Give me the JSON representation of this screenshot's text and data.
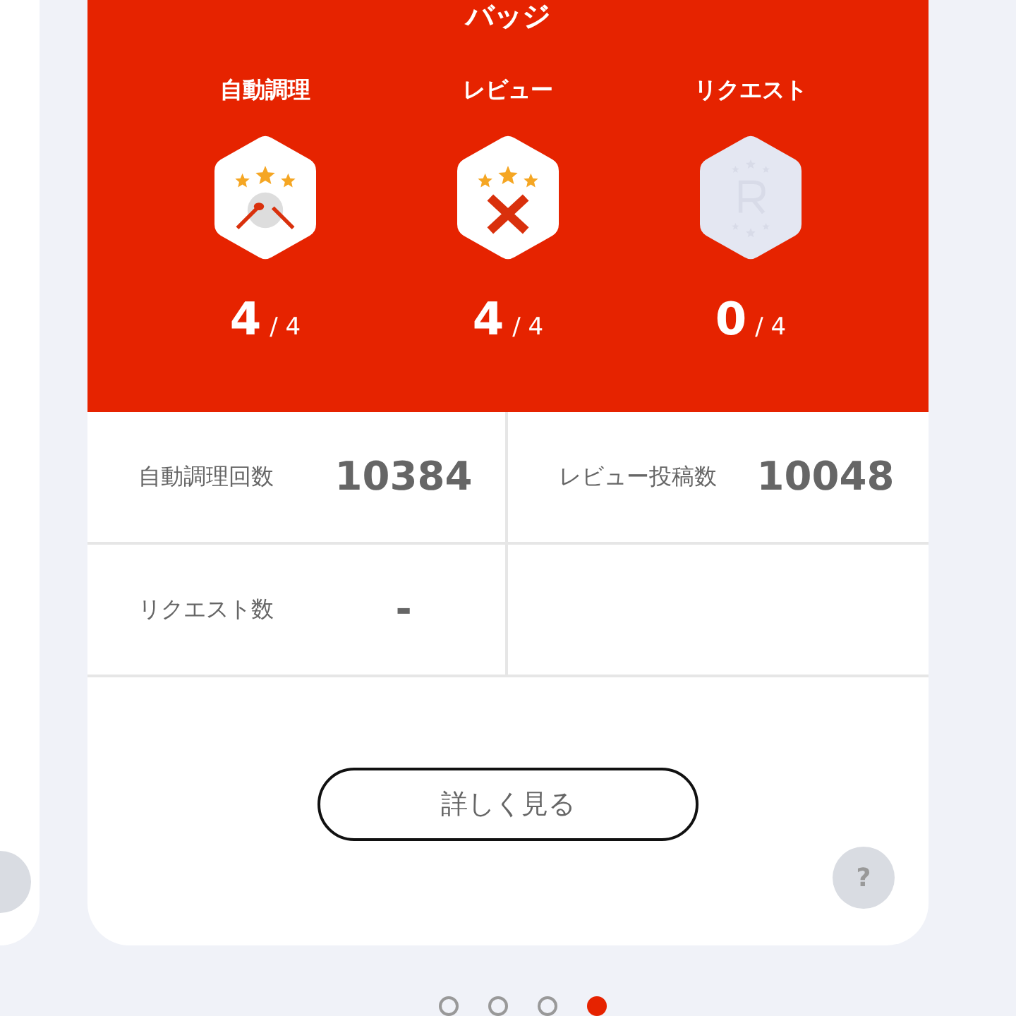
{
  "title": "バッジ",
  "badges": [
    {
      "label": "自動調理",
      "kind": "cooking",
      "earned": true,
      "count": "4",
      "total": "/ 4"
    },
    {
      "label": "レビュー",
      "kind": "review",
      "earned": true,
      "count": "4",
      "total": "/ 4"
    },
    {
      "label": "リクエスト",
      "kind": "request",
      "earned": false,
      "count": "0",
      "total": "/ 4"
    }
  ],
  "stats": [
    {
      "label": "自動調理回数",
      "value": "10384"
    },
    {
      "label": "レビュー投稿数",
      "value": "10048"
    },
    {
      "label": "リクエスト数",
      "value": "-"
    }
  ],
  "details_button": "詳しく見る",
  "help_button": "?",
  "pager": [
    {
      "selected": false
    },
    {
      "selected": false
    },
    {
      "selected": false
    },
    {
      "selected": true
    }
  ]
}
